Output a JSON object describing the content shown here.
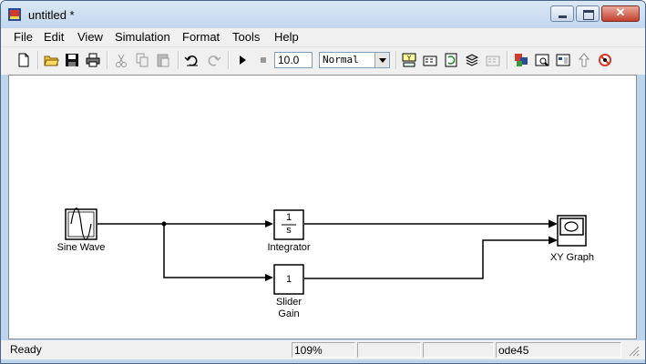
{
  "window": {
    "title": "untitled *"
  },
  "menu": [
    "File",
    "Edit",
    "View",
    "Simulation",
    "Format",
    "Tools",
    "Help"
  ],
  "toolbar": {
    "stop_time": "10.0",
    "sim_mode": "Normal",
    "buttons": [
      "new-model",
      "open",
      "save",
      "print",
      "cut",
      "copy",
      "paste",
      "undo",
      "redo",
      "start-simulation",
      "stop-simulation",
      "build-model",
      "update-diagram",
      "incremental-build",
      "refresh",
      "model-advisor",
      "debug",
      "library-browser",
      "model-explorer",
      "go-to-parent",
      "debugger"
    ]
  },
  "blocks": {
    "sine_wave": {
      "label": "Sine Wave"
    },
    "integrator": {
      "label": "Integrator",
      "numerator": "1",
      "denominator": "s"
    },
    "gain": {
      "label_line1": "Slider",
      "label_line2": "Gain",
      "value": "1"
    },
    "xy_graph": {
      "label": "XY Graph"
    }
  },
  "status": {
    "state": "Ready",
    "zoom": "109%",
    "cell3": "",
    "cell4": "",
    "solver": "ode45"
  }
}
